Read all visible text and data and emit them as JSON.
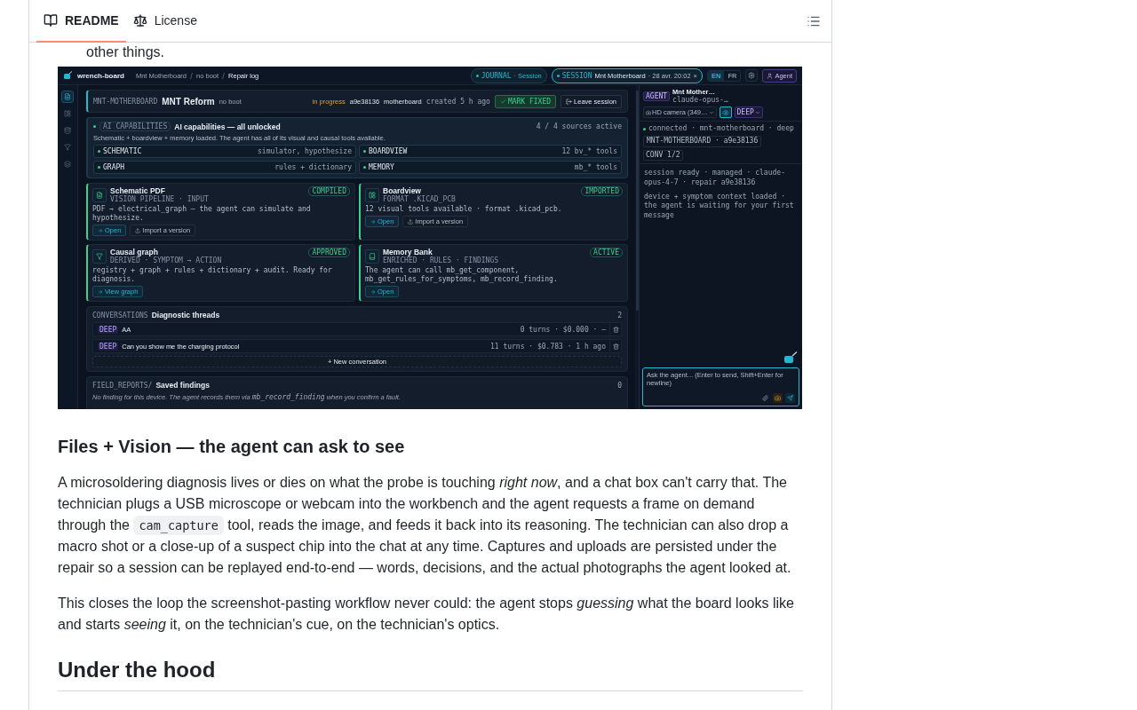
{
  "intro_fragment": "other things.",
  "tabs": [
    {
      "label": "README",
      "selected": true
    },
    {
      "label": "License",
      "selected": false
    }
  ],
  "screenshot": {
    "brand": "wrench-board",
    "breadcrumbs": [
      "Mnt Motherboard",
      "no boot",
      "Repair log"
    ],
    "journal_pill": {
      "tag": "JOURNAL",
      "label": "· Session"
    },
    "session_pill": {
      "tag": "SESSION",
      "device": "Mnt Motherboard",
      "date": "· 28 avr. 20:02",
      "close": "×"
    },
    "languages": [
      {
        "label": "EN",
        "selected": true
      },
      {
        "label": "FR",
        "selected": false
      }
    ],
    "agent_button": "Agent",
    "rail": [
      {
        "selected": true
      },
      {
        "selected": false
      },
      {
        "selected": false
      },
      {
        "selected": false
      },
      {
        "selected": false
      }
    ],
    "session": {
      "code": "MNT-MOTHERBOARD",
      "device": "MNT Reform",
      "symptom": "no boot",
      "status": "in progress",
      "repair_id": "a9e38136",
      "component": "motherboard",
      "created": "created 5 h ago",
      "mark_fixed": "MARK FIXED",
      "leave": "Leave session"
    },
    "capabilities": {
      "tag": "AI CAPABILITIES",
      "title": "AI capabilities — all unlocked",
      "count": "4 / 4 sources active",
      "description": "Schematic + boardview + memory loaded. The agent has all of its visual and causal tools available.",
      "items": [
        {
          "name": "SCHEMATIC",
          "detail": "simulator, hypothesize"
        },
        {
          "name": "BOARDVIEW",
          "detail": "12 bv_* tools"
        },
        {
          "name": "GRAPH",
          "detail": "rules + dictionary"
        },
        {
          "name": "MEMORY",
          "detail": "mb_* tools"
        }
      ]
    },
    "cards": [
      {
        "title": "Schematic PDF",
        "subtitle": "VISION PIPELINE · INPUT",
        "badge": "COMPILED",
        "description": "PDF → electrical_graph — the agent can simulate and hypothesize.",
        "actions": [
          {
            "label": "Open",
            "kind": "primary"
          },
          {
            "label": "Import a version",
            "kind": "secondary"
          }
        ]
      },
      {
        "title": "Boardview",
        "subtitle": "FORMAT .KICAD_PCB",
        "badge": "IMPORTED",
        "description": "12 visual tools available · format .kicad_pcb.",
        "actions": [
          {
            "label": "Open",
            "kind": "primary"
          },
          {
            "label": "Import a version",
            "kind": "secondary"
          }
        ]
      },
      {
        "title": "Causal graph",
        "subtitle": "DERIVED · SYMPTOM → ACTION",
        "badge": "APPROVED",
        "description": "registry + graph + rules + dictionary + audit. Ready for diagnosis.",
        "actions": [
          {
            "label": "View graph",
            "kind": "primary"
          }
        ]
      },
      {
        "title": "Memory Bank",
        "subtitle": "ENRICHED · RULES · FINDINGS",
        "badge": "ACTIVE",
        "description": "The agent can call mb_get_component, mb_get_rules_for_symptoms, mb_record_finding.",
        "actions": [
          {
            "label": "Open",
            "kind": "primary"
          }
        ]
      }
    ],
    "conversations": {
      "tag": "CONVERSATIONS",
      "title": "Diagnostic threads",
      "count": "2",
      "threads": [
        {
          "mode": "DEEP",
          "title": "AA",
          "meta": "0 turns · $0.000 · —"
        },
        {
          "mode": "DEEP",
          "title": "Can you show me the charging protocol",
          "meta": "11 turns · $0.783 · 1 h ago"
        }
      ],
      "new_button": "+ New conversation"
    },
    "findings": {
      "tag": "FIELD_REPORTS/",
      "title": "Saved findings",
      "count": "0",
      "empty": [
        {
          "kind": "text",
          "text": "No finding for this device. The agent records them via "
        },
        {
          "kind": "code",
          "text": "mb_record_finding"
        },
        {
          "kind": "text",
          "text": " when you confirm a fault."
        }
      ]
    },
    "agent": {
      "tag": "AGENT",
      "device": "Mnt Mother…",
      "model": "claude-opus-…",
      "camera": "HD camera (349…",
      "camera_view_on": true,
      "mode": "DEEP",
      "status": "connected · mnt-motherboard · deep",
      "repair": "MNT-MOTHERBOARD · a9e38136",
      "conversation": "CONV 1/2",
      "messages": [
        "session ready · managed · claude-opus-4-7 · repair a9e38136",
        "device + symptom context loaded · the agent is waiting for your first message"
      ],
      "input_placeholder": "Ask the agent... (Enter to send, Shift+Enter for newline)"
    }
  },
  "article": [
    {
      "kind": "heading",
      "text": "Files + Vision — the agent can ask to see"
    },
    {
      "kind": "paragraph",
      "parts": [
        {
          "kind": "text",
          "text": "A microsoldering diagnosis lives or dies on what the probe is touching *right now*, and a chat box can't carry that. The technician plugs a USB microscope or webcam into the workbench and the agent requests a frame on demand through the "
        },
        {
          "kind": "code",
          "text": "cam_capture"
        },
        {
          "kind": "text",
          "text": " tool, reads the image, and feeds it back into its reasoning. The technician can also drop a macro shot or a close-up of a suspect chip into the chat at any time. Captures and uploads are persisted under the repair so a session can be replayed end-to-end — words, decisions, and the actual photographs the agent looked at."
        }
      ]
    },
    {
      "kind": "paragraph",
      "parts": [
        {
          "kind": "text",
          "text": "This closes the loop the screenshot-pasting workflow never could: the agent stops *guessing* what the board looks like and starts *seeing* it, on the technician's cue, on the technician's optics."
        }
      ]
    },
    {
      "kind": "section_heading",
      "text": "Under the hood"
    }
  ]
}
